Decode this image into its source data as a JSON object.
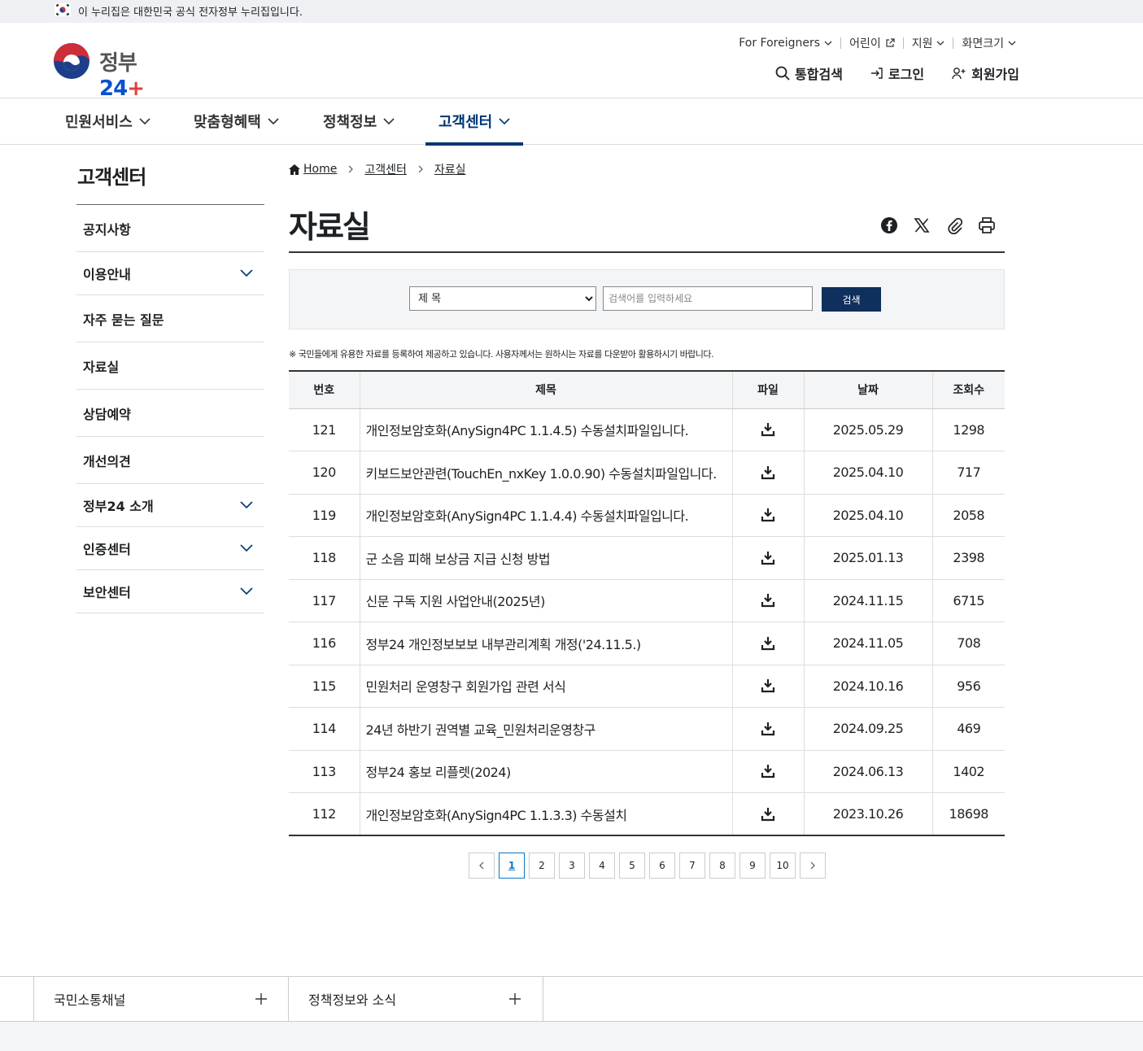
{
  "gov_banner": {
    "text": "이 누리집은 대한민국 공식 전자정부 누리집입니다."
  },
  "logo": {
    "text_a": "정부",
    "text_b": "24",
    "text_c": "+"
  },
  "util_nav": [
    {
      "label": "For Foreigners"
    },
    {
      "label": "어린이"
    },
    {
      "label": "지원"
    },
    {
      "label": "화면크기"
    }
  ],
  "user_nav": {
    "search": "통합검색",
    "login": "로그인",
    "signup": "회원가입"
  },
  "gnb": [
    {
      "label": "민원서비스"
    },
    {
      "label": "맞춤형혜택"
    },
    {
      "label": "정책정보"
    },
    {
      "label": "고객센터"
    }
  ],
  "lnb": {
    "title": "고객센터",
    "items": [
      {
        "label": "공지사항"
      },
      {
        "label": "이용안내"
      },
      {
        "label": "자주 묻는 질문"
      },
      {
        "label": "자료실"
      },
      {
        "label": "상담예약"
      },
      {
        "label": "개선의견"
      },
      {
        "label": "정부24 소개"
      },
      {
        "label": "인증센터"
      },
      {
        "label": "보안센터"
      }
    ]
  },
  "breadcrumb": {
    "home": "Home",
    "level1": "고객센터",
    "level2": "자료실"
  },
  "page_title": "자료실",
  "search": {
    "select_value": "제 목",
    "placeholder": "검색어를 입력하세요",
    "button": "검색"
  },
  "notice": "※ 국민들에게 유용한 자료를 등록하여 제공하고 있습니다. 사용자께서는 원하시는 자료를 다운받아 활용하시기 바랍니다.",
  "table": {
    "headers": [
      "번호",
      "제목",
      "파일",
      "날짜",
      "조회수"
    ],
    "rows": [
      {
        "no": "121",
        "title": "개인정보암호화(AnySign4PC 1.1.4.5) 수동설치파일입니다.",
        "date": "2025.05.29",
        "views": "1298"
      },
      {
        "no": "120",
        "title": "키보드보안관련(TouchEn_nxKey 1.0.0.90) 수동설치파일입니다.",
        "date": "2025.04.10",
        "views": "717"
      },
      {
        "no": "119",
        "title": "개인정보암호화(AnySign4PC 1.1.4.4) 수동설치파일입니다.",
        "date": "2025.04.10",
        "views": "2058"
      },
      {
        "no": "118",
        "title": "군 소음 피해 보상금 지급 신청 방법",
        "date": "2025.01.13",
        "views": "2398"
      },
      {
        "no": "117",
        "title": "신문 구독 지원 사업안내(2025년)",
        "date": "2024.11.15",
        "views": "6715"
      },
      {
        "no": "116",
        "title": "정부24 개인정보보보 내부관리계획 개정('24.11.5.)",
        "date": "2024.11.05",
        "views": "708"
      },
      {
        "no": "115",
        "title": "민원처리 운영창구 회원가입 관련 서식",
        "date": "2024.10.16",
        "views": "956"
      },
      {
        "no": "114",
        "title": "24년 하반기 권역별 교육_민원처리운영창구",
        "date": "2024.09.25",
        "views": "469"
      },
      {
        "no": "113",
        "title": "정부24 홍보 리플렛(2024)",
        "date": "2024.06.13",
        "views": "1402"
      },
      {
        "no": "112",
        "title": "개인정보암호화(AnySign4PC 1.1.3.3) 수동설치",
        "date": "2023.10.26",
        "views": "18698"
      }
    ]
  },
  "pager": {
    "pages": [
      "1",
      "2",
      "3",
      "4",
      "5",
      "6",
      "7",
      "8",
      "9",
      "10"
    ],
    "current": "1"
  },
  "footer": {
    "col1": "국민소통채널",
    "col2": "정책정보와 소식"
  },
  "colors": {
    "primary_navy": "#003675",
    "button_navy": "#0f2f5c",
    "active_page": "#0b78c8"
  }
}
